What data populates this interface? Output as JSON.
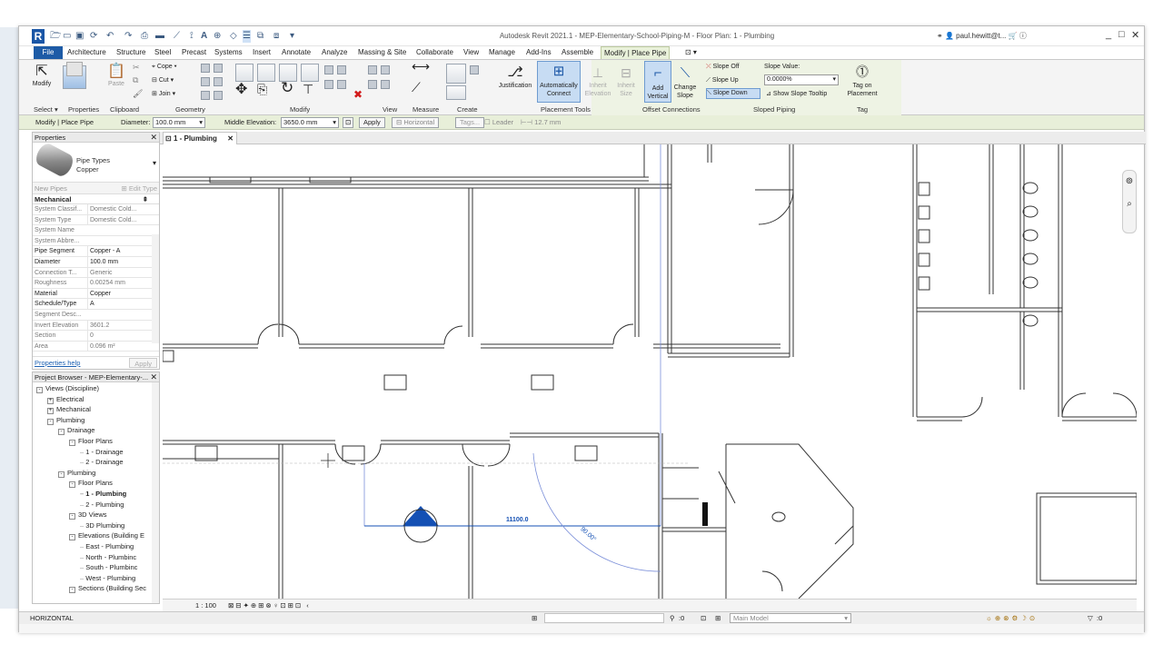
{
  "app": {
    "title": "Autodesk Revit 2021.1 - MEP-Elementary-School-Piping-M - Floor Plan: 1 - Plumbing",
    "user": "paul.hewitt@t...",
    "logo_letter": "R"
  },
  "ribbon_tabs": [
    "File",
    "Architecture",
    "Structure",
    "Steel",
    "Precast",
    "Systems",
    "Insert",
    "Annotate",
    "Analyze",
    "Massing & Site",
    "Collaborate",
    "View",
    "Manage",
    "Add-Ins",
    "Assemble",
    "Modify | Place Pipe"
  ],
  "ribbon": {
    "modify": "Modify",
    "paste": "Paste",
    "cope": "Cope",
    "cut": "Cut",
    "join": "Join",
    "justification": "Justification",
    "auto_connect": [
      "Automatically",
      "Connect"
    ],
    "inherit_elevation": [
      "Inherit",
      "Elevation"
    ],
    "inherit_size": [
      "Inherit",
      "Size"
    ],
    "add_vertical": [
      "Add",
      "Vertical"
    ],
    "change_slope": [
      "Change",
      "Slope"
    ],
    "slope_off": "Slope Off",
    "slope_up": "Slope Up",
    "slope_down": "Slope Down",
    "slope_value_label": "Slope Value:",
    "slope_value": "0.0000%",
    "show_slope_tooltip": "Show Slope Tooltip",
    "tag_on_placement": [
      "Tag on",
      "Placement"
    ],
    "panels": {
      "select": "Select",
      "properties": "Properties",
      "clipboard": "Clipboard",
      "geometry": "Geometry",
      "modify": "Modify",
      "view": "View",
      "measure": "Measure",
      "create": "Create",
      "placement_tools": "Placement Tools",
      "offset_connections": "Offset Connections",
      "sloped_piping": "Sloped Piping",
      "tag": "Tag"
    }
  },
  "options_bar": {
    "context": "Modify | Place Pipe",
    "diameter_label": "Diameter:",
    "diameter": "100.0 mm",
    "middle_elevation_label": "Middle Elevation:",
    "middle_elevation": "3650.0 mm",
    "apply": "Apply",
    "horizontal": "Horizontal",
    "tags": "Tags...",
    "leader": "Leader",
    "leader_length": "12.7 mm"
  },
  "properties": {
    "header": "Properties",
    "type_family": "Pipe Types",
    "type_name": "Copper",
    "selector": "New Pipes",
    "edit_type": "Edit Type",
    "category": "Mechanical",
    "rows": [
      {
        "k": "System Classif...",
        "v": "Domestic Cold..."
      },
      {
        "k": "System Type",
        "v": "Domestic Cold..."
      },
      {
        "k": "System Name",
        "v": ""
      },
      {
        "k": "System Abbre...",
        "v": ""
      },
      {
        "k": "Pipe Segment",
        "v": "Copper - A"
      },
      {
        "k": "Diameter",
        "v": "100.0 mm"
      },
      {
        "k": "Connection T...",
        "v": "Generic"
      },
      {
        "k": "Roughness",
        "v": "0.00254 mm"
      },
      {
        "k": "Material",
        "v": "Copper"
      },
      {
        "k": "Schedule/Type",
        "v": "A"
      },
      {
        "k": "Segment Desc...",
        "v": ""
      },
      {
        "k": "Invert Elevation",
        "v": "3601.2"
      },
      {
        "k": "Section",
        "v": "0"
      },
      {
        "k": "Area",
        "v": "0.096 m²"
      }
    ],
    "help": "Properties help",
    "apply": "Apply"
  },
  "browser": {
    "header": "Project Browser - MEP-Elementary-...",
    "nodes": [
      {
        "t": "Views (Discipline)",
        "lvl": 0,
        "ex": "-"
      },
      {
        "t": "Electrical",
        "lvl": 1,
        "ex": "+"
      },
      {
        "t": "Mechanical",
        "lvl": 1,
        "ex": "+"
      },
      {
        "t": "Plumbing",
        "lvl": 1,
        "ex": "-"
      },
      {
        "t": "Drainage",
        "lvl": 2,
        "ex": "-"
      },
      {
        "t": "Floor Plans",
        "lvl": 3,
        "ex": "-"
      },
      {
        "t": "1 - Drainage",
        "lvl": 4,
        "ex": ""
      },
      {
        "t": "2 - Drainage",
        "lvl": 4,
        "ex": ""
      },
      {
        "t": "Plumbing",
        "lvl": 2,
        "ex": "-"
      },
      {
        "t": "Floor Plans",
        "lvl": 3,
        "ex": "-"
      },
      {
        "t": "1 - Plumbing",
        "lvl": 4,
        "ex": "",
        "bold": true
      },
      {
        "t": "2 - Plumbing",
        "lvl": 4,
        "ex": ""
      },
      {
        "t": "3D Views",
        "lvl": 3,
        "ex": "-"
      },
      {
        "t": "3D Plumbing",
        "lvl": 4,
        "ex": ""
      },
      {
        "t": "Elevations (Building E",
        "lvl": 3,
        "ex": "-"
      },
      {
        "t": "East - Plumbing",
        "lvl": 4,
        "ex": ""
      },
      {
        "t": "North - Plumbinc",
        "lvl": 4,
        "ex": ""
      },
      {
        "t": "South - Plumbinc",
        "lvl": 4,
        "ex": ""
      },
      {
        "t": "West - Plumbing",
        "lvl": 4,
        "ex": ""
      },
      {
        "t": "Sections (Building Sec",
        "lvl": 3,
        "ex": "-"
      }
    ]
  },
  "view_tab": "1 - Plumbing",
  "canvas": {
    "dimension": "11100.0",
    "angle": "90.00°"
  },
  "view_bar": {
    "scale": "1 : 100"
  },
  "status": {
    "text": "HORIZONTAL",
    "model": "Main Model",
    "zero1": ":0",
    "zero2": ":0"
  },
  "colors": {
    "file_tab": "#1d5ba6",
    "contextual": "#e9f1da",
    "accent_blue": "#1a56a6",
    "pipe_blue": "#1450b4"
  }
}
